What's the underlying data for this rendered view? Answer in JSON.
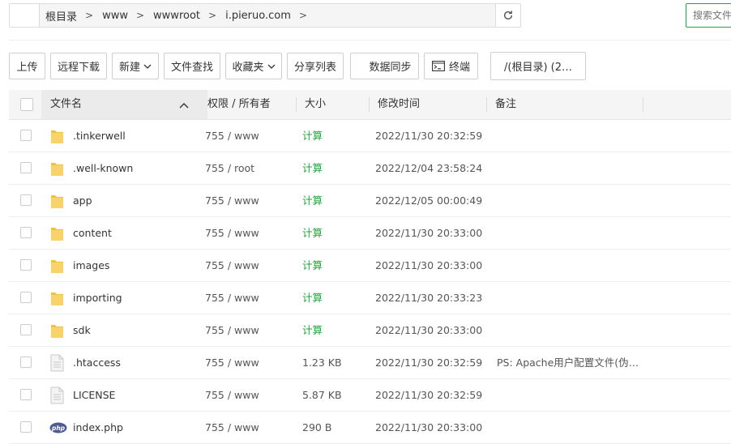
{
  "path": {
    "crumbs": [
      "根目录",
      "www",
      "wwwroot",
      "i.pieruo.com"
    ],
    "separator": ">"
  },
  "search": {
    "placeholder": "搜索文件"
  },
  "toolbar": {
    "upload": "上传",
    "remote_download": "远程下载",
    "new": "新建",
    "file_search": "文件查找",
    "favorites": "收藏夹",
    "share_list": "分享列表",
    "data_sync": "数据同步",
    "terminal": "终端",
    "root_tab": "/(根目录) (2…"
  },
  "table": {
    "columns": {
      "name": "文件名",
      "permission": "权限 / 所有者",
      "size": "大小",
      "modified": "修改时间",
      "remark": "备注"
    },
    "rows": [
      {
        "type": "folder",
        "name": ".tinkerwell",
        "perm": "755 / www",
        "size": "计算",
        "modified": "2022/11/30 20:32:59",
        "remark": ""
      },
      {
        "type": "folder",
        "name": ".well-known",
        "perm": "755 / root",
        "size": "计算",
        "modified": "2022/12/04 23:58:24",
        "remark": ""
      },
      {
        "type": "folder",
        "name": "app",
        "perm": "755 / www",
        "size": "计算",
        "modified": "2022/12/05 00:00:49",
        "remark": ""
      },
      {
        "type": "folder",
        "name": "content",
        "perm": "755 / www",
        "size": "计算",
        "modified": "2022/11/30 20:33:00",
        "remark": ""
      },
      {
        "type": "folder",
        "name": "images",
        "perm": "755 / www",
        "size": "计算",
        "modified": "2022/11/30 20:33:00",
        "remark": ""
      },
      {
        "type": "folder",
        "name": "importing",
        "perm": "755 / www",
        "size": "计算",
        "modified": "2022/11/30 20:33:23",
        "remark": ""
      },
      {
        "type": "folder",
        "name": "sdk",
        "perm": "755 / www",
        "size": "计算",
        "modified": "2022/11/30 20:33:00",
        "remark": ""
      },
      {
        "type": "file",
        "name": ".htaccess",
        "perm": "755 / www",
        "size": "1.23 KB",
        "modified": "2022/11/30 20:32:59",
        "remark": "PS: Apache用户配置文件(伪…"
      },
      {
        "type": "file",
        "name": "LICENSE",
        "perm": "755 / www",
        "size": "5.87 KB",
        "modified": "2022/11/30 20:32:59",
        "remark": ""
      },
      {
        "type": "php",
        "name": "index.php",
        "perm": "755 / www",
        "size": "290 B",
        "modified": "2022/11/30 20:33:00",
        "remark": ""
      }
    ]
  },
  "icons": {
    "folder": "folder-icon",
    "file": "file-icon",
    "php": "php-file-icon",
    "refresh": "refresh-icon",
    "terminal": "terminal-icon",
    "sort": "sort-asc-icon"
  },
  "colors": {
    "accent": "#20a53a",
    "folder": "#f7c948",
    "php_badge": "#4f5b93"
  }
}
